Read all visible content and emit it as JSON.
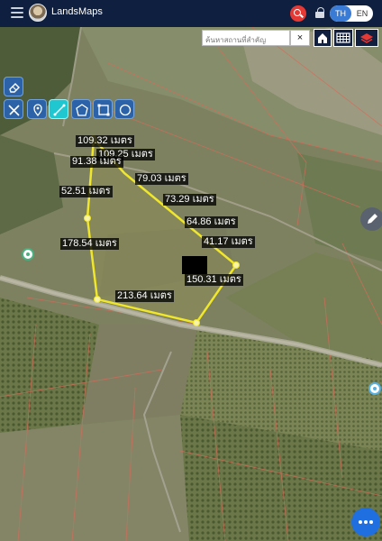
{
  "app": {
    "title": "LandsMaps",
    "lang_th": "TH",
    "lang_en": "EN"
  },
  "search": {
    "placeholder": "ค้นหาสถานที่สำคัญ",
    "clear_label": "×"
  },
  "toolbar_top": [
    {
      "name": "eraser-icon"
    },
    {
      "name": "ruler-icon"
    },
    {
      "name": "pin-icon"
    },
    {
      "name": "measure-line-icon"
    },
    {
      "name": "polygon-icon"
    },
    {
      "name": "rectangle-icon"
    },
    {
      "name": "circle-icon"
    }
  ],
  "measurements": [
    {
      "id": "m1",
      "text": "109.32 เมตร"
    },
    {
      "id": "m2",
      "text": "109.25 เมตร"
    },
    {
      "id": "m3",
      "text": "91.38 เมตร"
    },
    {
      "id": "m4",
      "text": "79.03 เมตร"
    },
    {
      "id": "m5",
      "text": "52.51 เมตร"
    },
    {
      "id": "m6",
      "text": "73.29 เมตร"
    },
    {
      "id": "m7",
      "text": "64.86 เมตร"
    },
    {
      "id": "m8",
      "text": "41.17 เมตร"
    },
    {
      "id": "m9",
      "text": "178.54 เมตร"
    },
    {
      "id": "m10",
      "text": "150.31 เมตร"
    },
    {
      "id": "m11",
      "text": "213.64 เมตร"
    }
  ],
  "colors": {
    "topbar": "#0e1f3f",
    "accent": "#3a7bd5",
    "polygon": "#f0e62a",
    "search_button": "#e53935",
    "fab": "#1f6fe0"
  }
}
